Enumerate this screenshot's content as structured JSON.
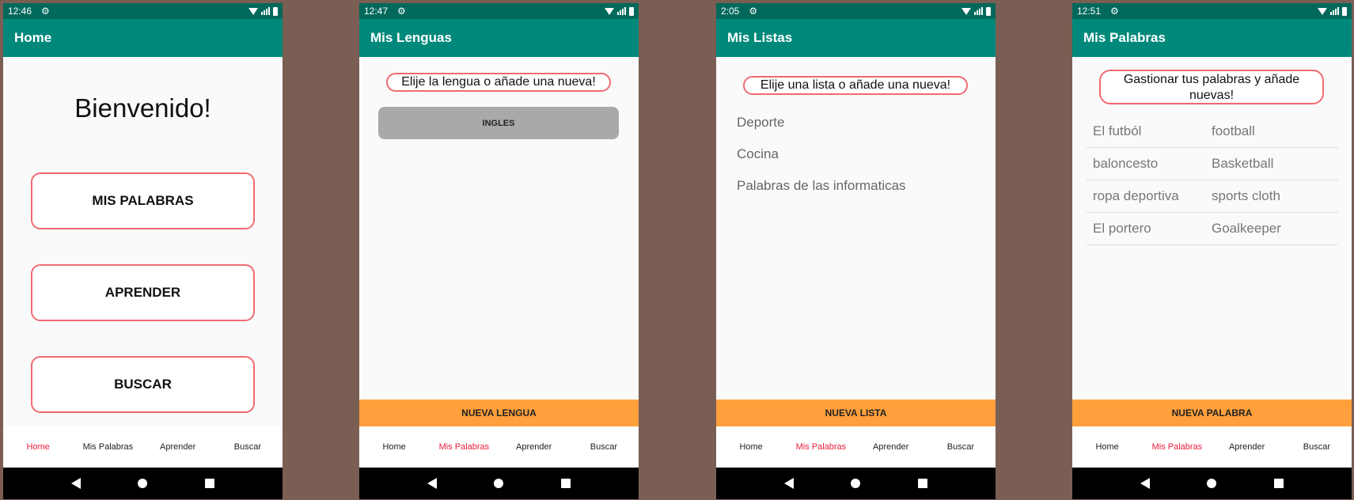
{
  "screens": {
    "home": {
      "time": "12:46",
      "title": "Home",
      "welcome": "Bienvenido!",
      "buttons": [
        "MIS PALABRAS",
        "APRENDER",
        "BUSCAR"
      ],
      "nav": [
        "Home",
        "Mis Palabras",
        "Aprender",
        "Buscar"
      ],
      "active_nav": 0
    },
    "lenguas": {
      "time": "12:47",
      "title": "Mis Lenguas",
      "prompt": "Elije la lengua o añade una nueva!",
      "language_button": "INGLES",
      "action": "NUEVA LENGUA",
      "nav": [
        "Home",
        "Mis Palabras",
        "Aprender",
        "Buscar"
      ],
      "active_nav": 1
    },
    "listas": {
      "time": "2:05",
      "title": "Mis Listas",
      "prompt": "Elije una lista o añade una nueva!",
      "items": [
        "Deporte",
        "Cocina",
        "Palabras de las informaticas"
      ],
      "action": "NUEVA LISTA",
      "nav": [
        "Home",
        "Mis Palabras",
        "Aprender",
        "Buscar"
      ],
      "active_nav": 1
    },
    "palabras": {
      "time": "12:51",
      "title": "Mis Palabras",
      "prompt_line1": "Gastionar tus palabras y añade",
      "prompt_line2": "nuevas!",
      "words": [
        {
          "es": "El futból",
          "en": "football"
        },
        {
          "es": "baloncesto",
          "en": "Basketball"
        },
        {
          "es": "ropa deportiva",
          "en": "sports cloth"
        },
        {
          "es": "El portero",
          "en": "Goalkeeper"
        }
      ],
      "action": "NUEVA PALABRA",
      "nav": [
        "Home",
        "Mis Palabras",
        "Aprender",
        "Buscar"
      ],
      "active_nav": 1
    }
  },
  "icons": {
    "status": [
      "gear-icon",
      "wifi-icon",
      "signal-icon",
      "battery-icon"
    ],
    "system_nav": [
      "back-icon",
      "home-circle-icon",
      "recents-icon"
    ]
  },
  "colors": {
    "status_bar": "#00695c",
    "app_bar": "#00897b",
    "accent_outline": "#f06a73",
    "action_bar": "#ffa03c",
    "active_nav": "#e91e3a",
    "language_button": "#a9a9a9",
    "background": "#7a5e54"
  }
}
